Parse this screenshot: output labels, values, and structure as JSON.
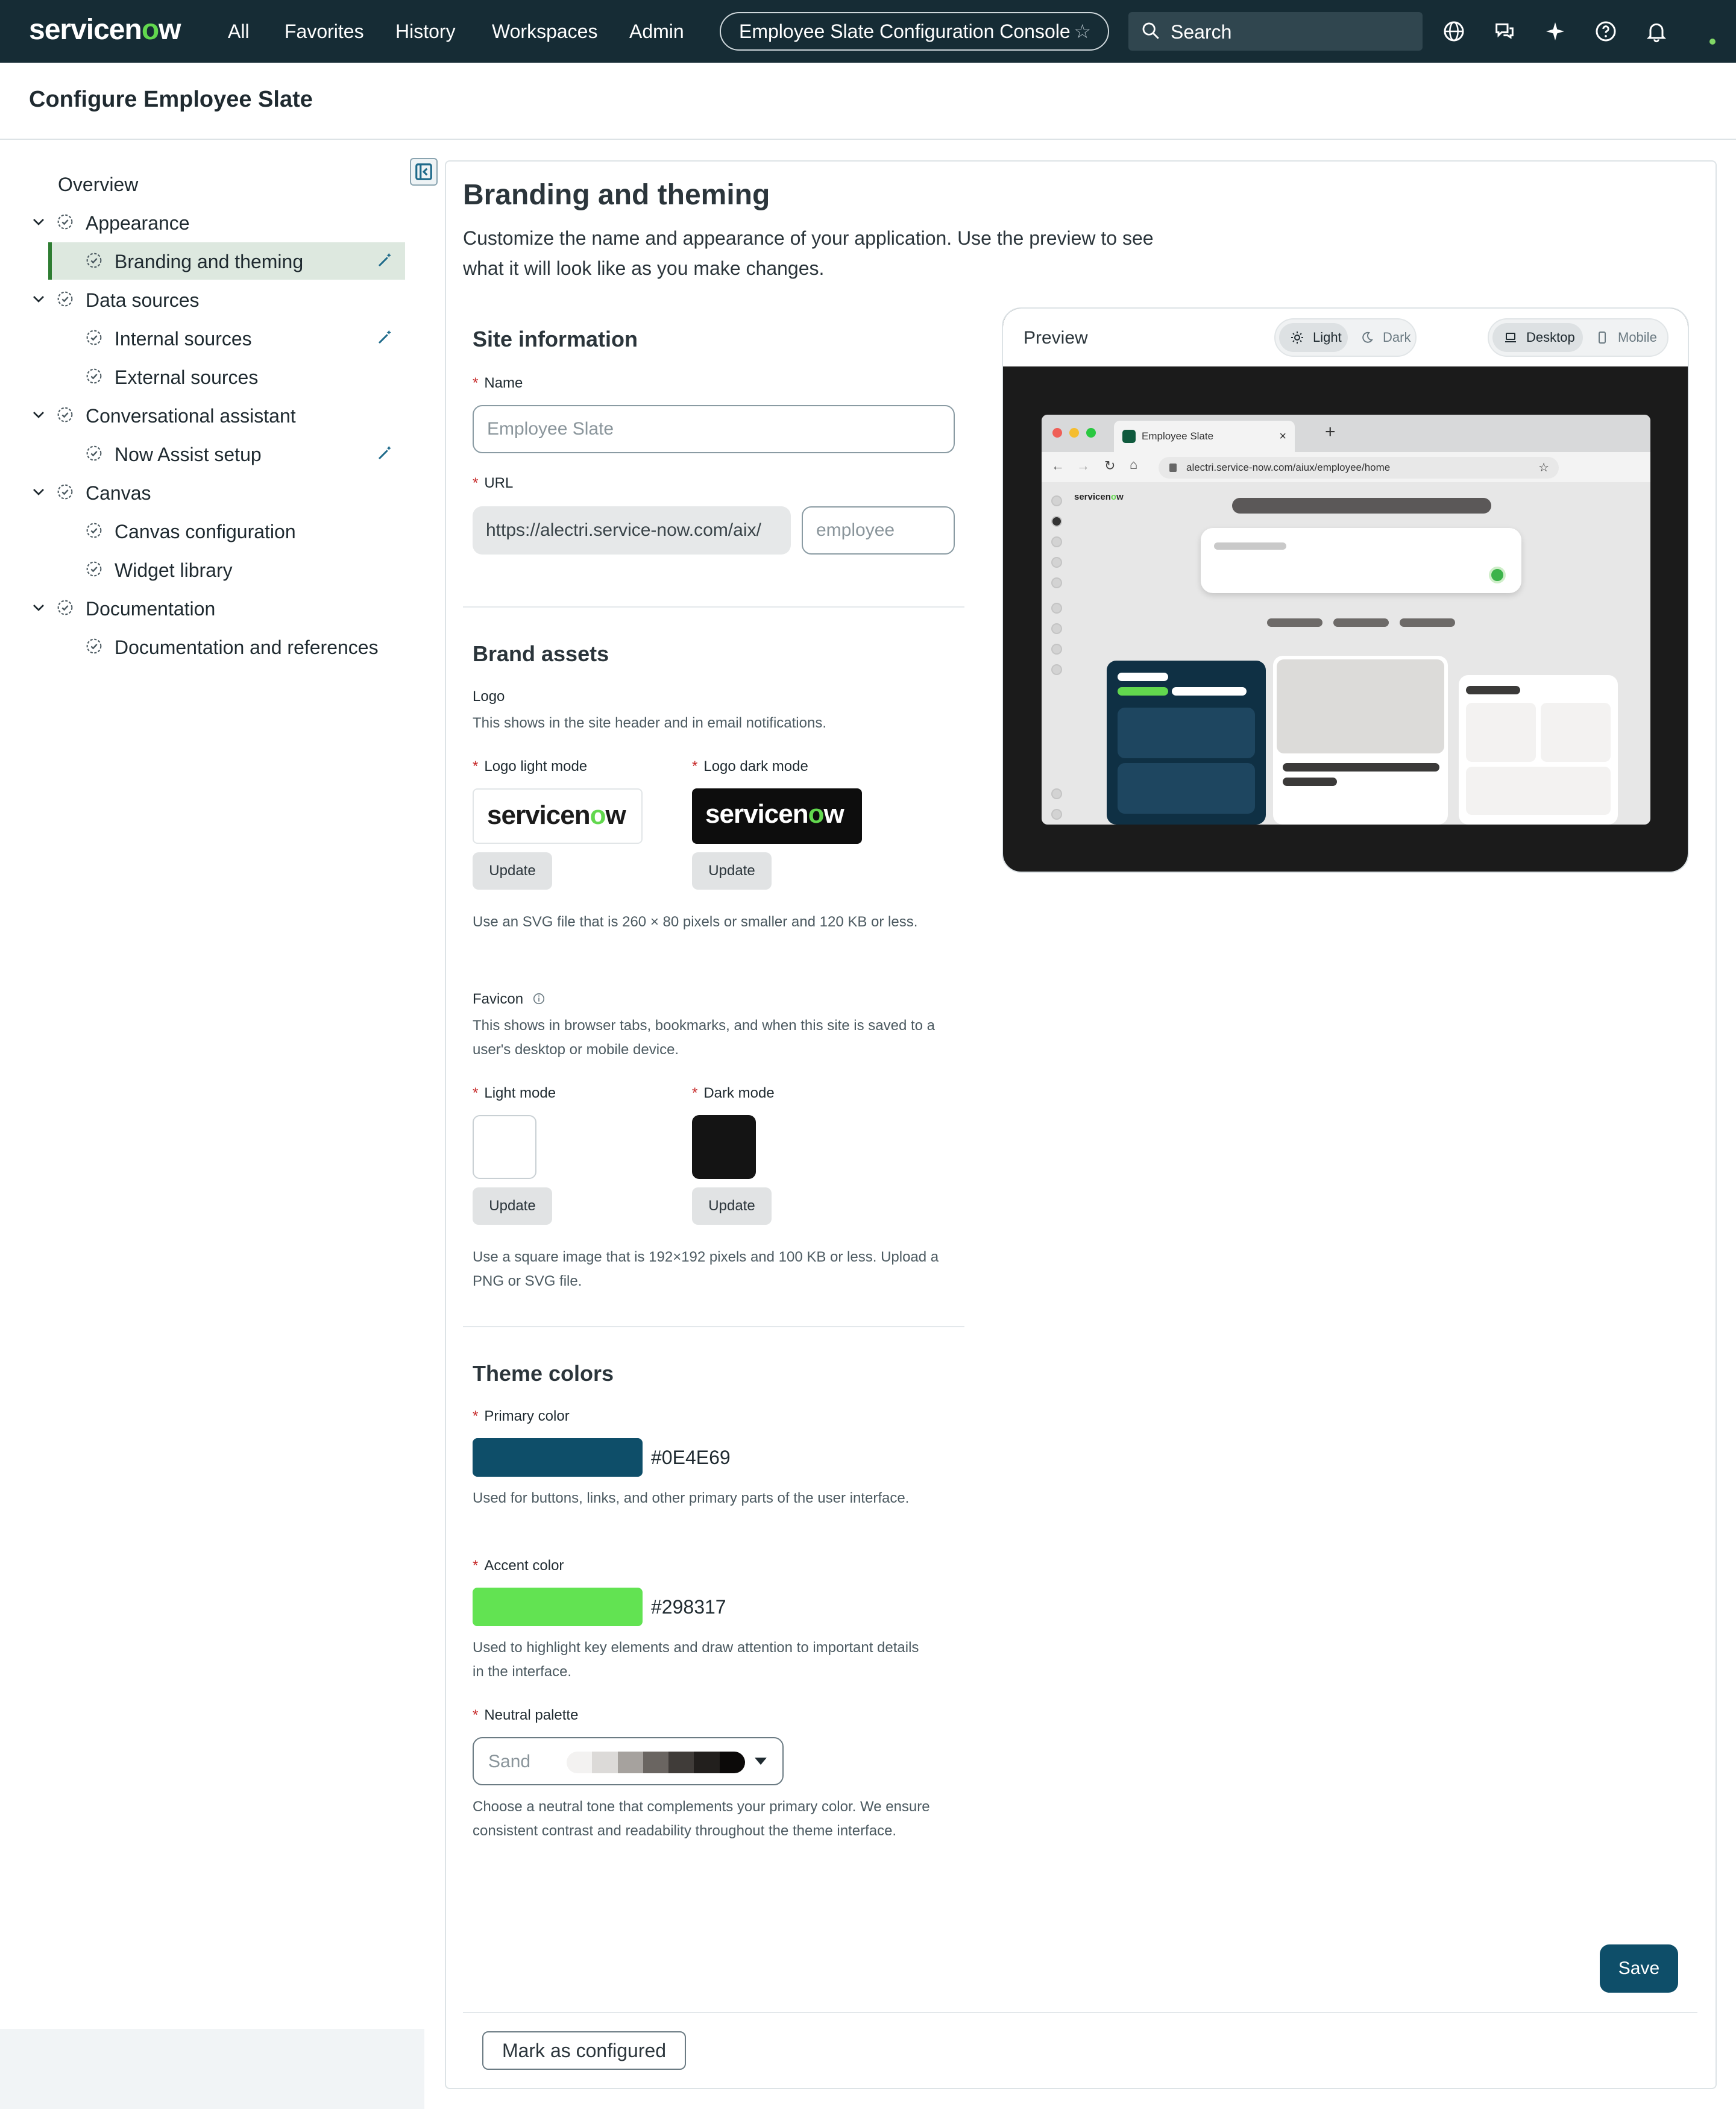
{
  "topnav": {
    "logo_pre": "servicen",
    "logo_o": "o",
    "logo_post": "w",
    "links": [
      "All",
      "Favorites",
      "History",
      "Workspaces",
      "Admin"
    ],
    "console_title": "Employee Slate Configuration Console",
    "search_placeholder": "Search",
    "icons": [
      "globe-icon",
      "chat-icon",
      "sparkle-icon",
      "help-icon",
      "bell-icon"
    ],
    "nav_bg": "#162c35",
    "presence_color": "#81d766"
  },
  "page": {
    "title": "Configure Employee Slate"
  },
  "sidebar": {
    "overview": "Overview",
    "items": [
      {
        "label": "Appearance",
        "level": 0
      },
      {
        "label": "Branding and theming",
        "level": 1,
        "active": true,
        "wand": true
      },
      {
        "label": "Data sources",
        "level": 0
      },
      {
        "label": "Internal sources",
        "level": 1,
        "wand": true
      },
      {
        "label": "External sources",
        "level": 1
      },
      {
        "label": "Conversational assistant",
        "level": 0
      },
      {
        "label": "Now Assist setup",
        "level": 1,
        "wand": true
      },
      {
        "label": "Canvas",
        "level": 0
      },
      {
        "label": "Canvas configuration",
        "level": 1
      },
      {
        "label": "Widget library",
        "level": 1
      },
      {
        "label": "Documentation",
        "level": 0
      },
      {
        "label": "Documentation and references",
        "level": 1
      }
    ]
  },
  "main": {
    "title": "Branding and theming",
    "description": "Customize the name and appearance of your application. Use the preview to see what it will look like as you make changes.",
    "site_info": {
      "title": "Site information",
      "name_label": "Name",
      "name_placeholder": "Employee Slate",
      "url_label": "URL",
      "url_prefix": "https://alectri.service-now.com/aix/",
      "url_suffix_placeholder": "employee"
    },
    "brand_assets": {
      "title": "Brand assets",
      "logo_label": "Logo",
      "logo_help": "This shows in the site header and in email notifications.",
      "logo_light_label": "Logo light mode",
      "logo_dark_label": "Logo dark mode",
      "update_label": "Update",
      "logo_size_help": "Use an SVG file that is 260 × 80 pixels or smaller and 120 KB or less.",
      "favicon_label": "Favicon",
      "favicon_help": "This shows in browser tabs, bookmarks, and when this site is saved to a user's desktop or mobile device.",
      "favicon_light_label": "Light mode",
      "favicon_dark_label": "Dark mode",
      "favicon_size_help": "Use a square image that is 192×192 pixels and 100 KB or less. Upload a PNG or SVG file."
    },
    "theme_colors": {
      "title": "Theme colors",
      "primary_label": "Primary color",
      "primary_value": "#0E4E69",
      "primary_help": "Used for buttons, links, and other primary parts of the user interface.",
      "accent_label": "Accent color",
      "accent_value": "#298317",
      "accent_swatch": "#62e352",
      "accent_help": "Used to highlight key elements and draw attention to important details in the interface.",
      "neutral_label": "Neutral palette",
      "neutral_value": "Sand",
      "neutral_swatches": [
        "#f3f2f1",
        "#dcdad8",
        "#a6a29e",
        "#6a6561",
        "#403c39",
        "#221f1d",
        "#0c0a09"
      ],
      "neutral_help": "Choose a neutral tone that complements your primary color. We ensure consistent contrast and readability throughout the theme interface."
    },
    "save_label": "Save",
    "mark_configured_label": "Mark as configured"
  },
  "preview": {
    "title": "Preview",
    "mode_light": "Light",
    "mode_dark": "Dark",
    "device_desktop": "Desktop",
    "device_mobile": "Mobile",
    "tab_title": "Employee Slate",
    "url": "alectri.service-now.com/aiux/employee/home",
    "brand_pre": "servicen",
    "brand_o": "o",
    "brand_post": "w"
  }
}
